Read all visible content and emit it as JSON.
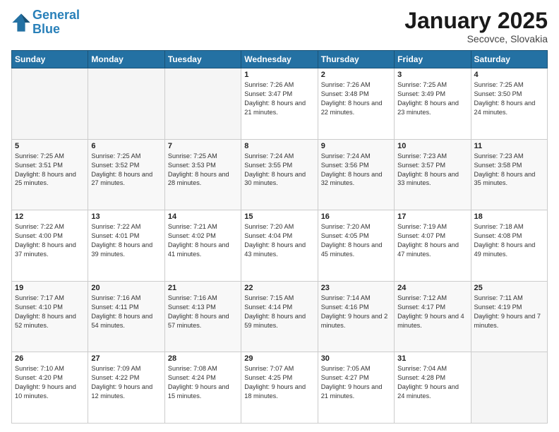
{
  "header": {
    "logo_line1": "General",
    "logo_line2": "Blue",
    "month": "January 2025",
    "location": "Secovce, Slovakia"
  },
  "weekdays": [
    "Sunday",
    "Monday",
    "Tuesday",
    "Wednesday",
    "Thursday",
    "Friday",
    "Saturday"
  ],
  "weeks": [
    [
      {
        "day": "",
        "info": ""
      },
      {
        "day": "",
        "info": ""
      },
      {
        "day": "",
        "info": ""
      },
      {
        "day": "1",
        "info": "Sunrise: 7:26 AM\nSunset: 3:47 PM\nDaylight: 8 hours and 21 minutes."
      },
      {
        "day": "2",
        "info": "Sunrise: 7:26 AM\nSunset: 3:48 PM\nDaylight: 8 hours and 22 minutes."
      },
      {
        "day": "3",
        "info": "Sunrise: 7:25 AM\nSunset: 3:49 PM\nDaylight: 8 hours and 23 minutes."
      },
      {
        "day": "4",
        "info": "Sunrise: 7:25 AM\nSunset: 3:50 PM\nDaylight: 8 hours and 24 minutes."
      }
    ],
    [
      {
        "day": "5",
        "info": "Sunrise: 7:25 AM\nSunset: 3:51 PM\nDaylight: 8 hours and 25 minutes."
      },
      {
        "day": "6",
        "info": "Sunrise: 7:25 AM\nSunset: 3:52 PM\nDaylight: 8 hours and 27 minutes."
      },
      {
        "day": "7",
        "info": "Sunrise: 7:25 AM\nSunset: 3:53 PM\nDaylight: 8 hours and 28 minutes."
      },
      {
        "day": "8",
        "info": "Sunrise: 7:24 AM\nSunset: 3:55 PM\nDaylight: 8 hours and 30 minutes."
      },
      {
        "day": "9",
        "info": "Sunrise: 7:24 AM\nSunset: 3:56 PM\nDaylight: 8 hours and 32 minutes."
      },
      {
        "day": "10",
        "info": "Sunrise: 7:23 AM\nSunset: 3:57 PM\nDaylight: 8 hours and 33 minutes."
      },
      {
        "day": "11",
        "info": "Sunrise: 7:23 AM\nSunset: 3:58 PM\nDaylight: 8 hours and 35 minutes."
      }
    ],
    [
      {
        "day": "12",
        "info": "Sunrise: 7:22 AM\nSunset: 4:00 PM\nDaylight: 8 hours and 37 minutes."
      },
      {
        "day": "13",
        "info": "Sunrise: 7:22 AM\nSunset: 4:01 PM\nDaylight: 8 hours and 39 minutes."
      },
      {
        "day": "14",
        "info": "Sunrise: 7:21 AM\nSunset: 4:02 PM\nDaylight: 8 hours and 41 minutes."
      },
      {
        "day": "15",
        "info": "Sunrise: 7:20 AM\nSunset: 4:04 PM\nDaylight: 8 hours and 43 minutes."
      },
      {
        "day": "16",
        "info": "Sunrise: 7:20 AM\nSunset: 4:05 PM\nDaylight: 8 hours and 45 minutes."
      },
      {
        "day": "17",
        "info": "Sunrise: 7:19 AM\nSunset: 4:07 PM\nDaylight: 8 hours and 47 minutes."
      },
      {
        "day": "18",
        "info": "Sunrise: 7:18 AM\nSunset: 4:08 PM\nDaylight: 8 hours and 49 minutes."
      }
    ],
    [
      {
        "day": "19",
        "info": "Sunrise: 7:17 AM\nSunset: 4:10 PM\nDaylight: 8 hours and 52 minutes."
      },
      {
        "day": "20",
        "info": "Sunrise: 7:16 AM\nSunset: 4:11 PM\nDaylight: 8 hours and 54 minutes."
      },
      {
        "day": "21",
        "info": "Sunrise: 7:16 AM\nSunset: 4:13 PM\nDaylight: 8 hours and 57 minutes."
      },
      {
        "day": "22",
        "info": "Sunrise: 7:15 AM\nSunset: 4:14 PM\nDaylight: 8 hours and 59 minutes."
      },
      {
        "day": "23",
        "info": "Sunrise: 7:14 AM\nSunset: 4:16 PM\nDaylight: 9 hours and 2 minutes."
      },
      {
        "day": "24",
        "info": "Sunrise: 7:12 AM\nSunset: 4:17 PM\nDaylight: 9 hours and 4 minutes."
      },
      {
        "day": "25",
        "info": "Sunrise: 7:11 AM\nSunset: 4:19 PM\nDaylight: 9 hours and 7 minutes."
      }
    ],
    [
      {
        "day": "26",
        "info": "Sunrise: 7:10 AM\nSunset: 4:20 PM\nDaylight: 9 hours and 10 minutes."
      },
      {
        "day": "27",
        "info": "Sunrise: 7:09 AM\nSunset: 4:22 PM\nDaylight: 9 hours and 12 minutes."
      },
      {
        "day": "28",
        "info": "Sunrise: 7:08 AM\nSunset: 4:24 PM\nDaylight: 9 hours and 15 minutes."
      },
      {
        "day": "29",
        "info": "Sunrise: 7:07 AM\nSunset: 4:25 PM\nDaylight: 9 hours and 18 minutes."
      },
      {
        "day": "30",
        "info": "Sunrise: 7:05 AM\nSunset: 4:27 PM\nDaylight: 9 hours and 21 minutes."
      },
      {
        "day": "31",
        "info": "Sunrise: 7:04 AM\nSunset: 4:28 PM\nDaylight: 9 hours and 24 minutes."
      },
      {
        "day": "",
        "info": ""
      }
    ]
  ]
}
